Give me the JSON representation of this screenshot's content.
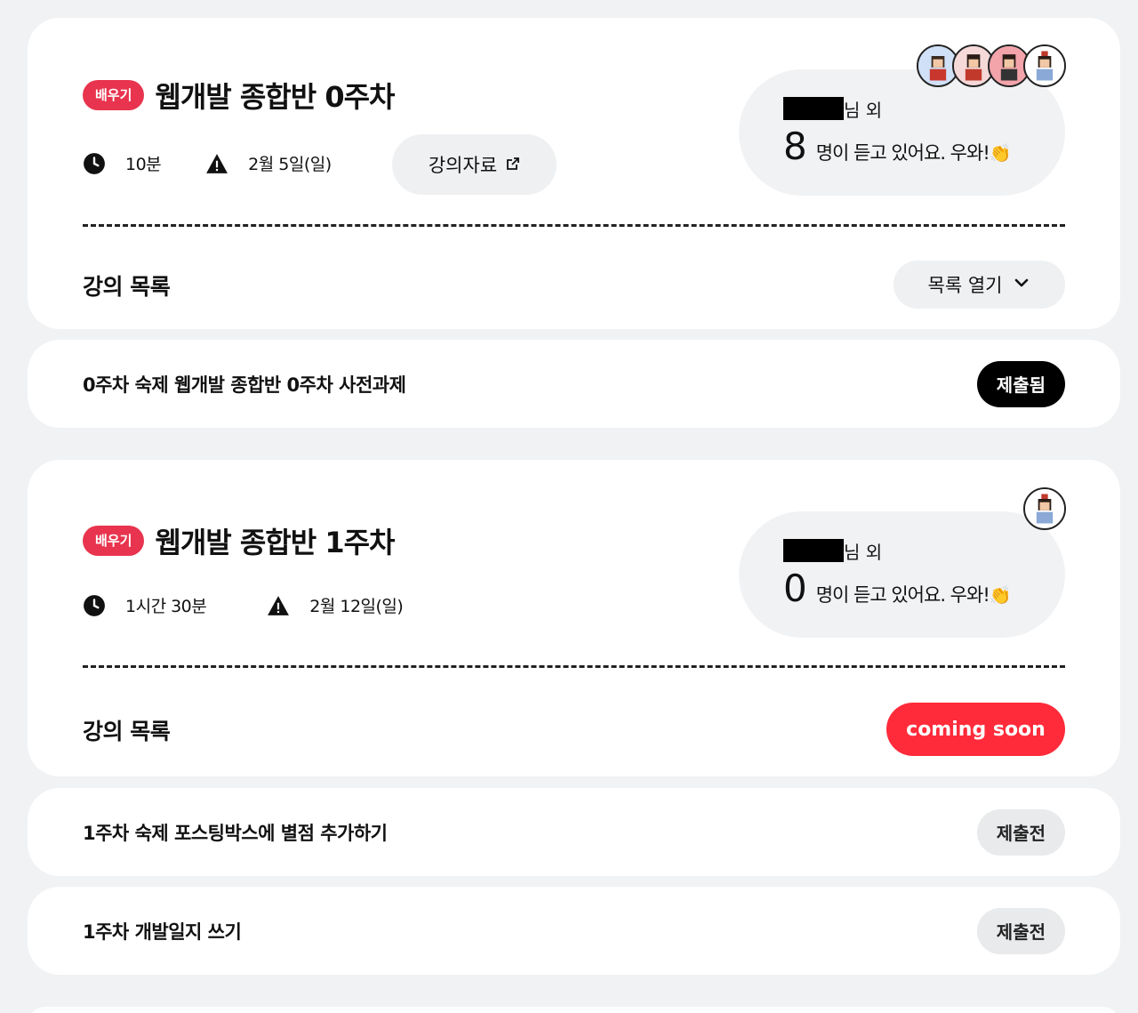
{
  "weeks": [
    {
      "badge": "배우기",
      "title": "웹개발 종합반 0주차",
      "duration": "10분",
      "due": "2월 5일(일)",
      "material_label": "강의자료",
      "listener_suffix": "님 외",
      "listener_count": "8",
      "listener_text": "명이 듣고 있어요. 우와!",
      "clap": "👏",
      "list_label": "강의 목록",
      "list_button": "목록 열기"
    },
    {
      "badge": "배우기",
      "title": "웹개발 종합반 1주차",
      "duration": "1시간 30분",
      "due": "2월 12일(일)",
      "listener_suffix": "님 외",
      "listener_count": "0",
      "listener_text": "명이 듣고 있어요. 우와!",
      "clap": "👏",
      "list_label": "강의 목록",
      "list_button": "coming soon"
    }
  ],
  "homework": [
    {
      "title": "0주차 숙제 웹개발 종합반 0주차 사전과제",
      "status": "제출됨"
    },
    {
      "title": "1주차 숙제 포스팅박스에 별점 추가하기",
      "status": "제출전"
    },
    {
      "title": "1주차 개발일지 쓰기",
      "status": "제출전"
    }
  ],
  "icons": {
    "clock": "clock-icon",
    "warning": "warning-icon",
    "external_link": "external-link-icon",
    "chevron": "chevron-down-icon"
  },
  "colors": {
    "badge": "#e8344e",
    "coming_soon": "#ff2b3a",
    "submitted": "#000000",
    "pending": "#e8eaec",
    "background": "#f1f2f4"
  }
}
